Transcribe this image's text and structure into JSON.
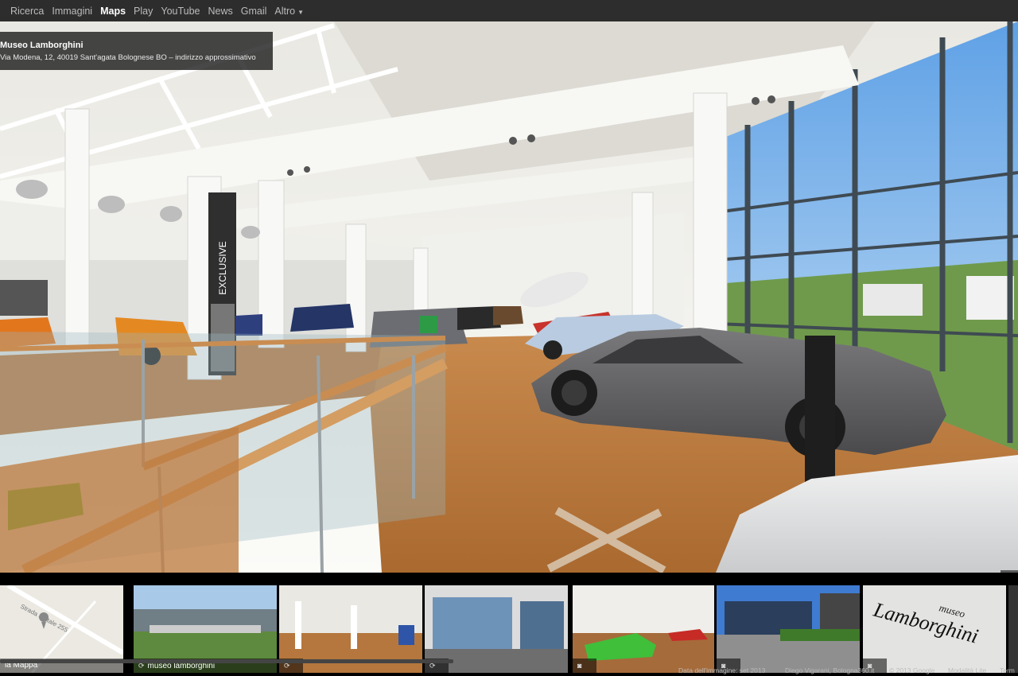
{
  "topbar": {
    "items": [
      {
        "label": "Ricerca",
        "active": false
      },
      {
        "label": "Immagini",
        "active": false
      },
      {
        "label": "Maps",
        "active": true
      },
      {
        "label": "Play",
        "active": false
      },
      {
        "label": "YouTube",
        "active": false
      },
      {
        "label": "News",
        "active": false
      },
      {
        "label": "Gmail",
        "active": false
      },
      {
        "label": "Altro",
        "active": false,
        "icon": "chevron-down-icon"
      }
    ]
  },
  "place": {
    "title": "Museo Lamborghini",
    "address": "Via Modena, 12, 40019 Sant'agata Bolognese BO – indirizzo approssimativo"
  },
  "pano": {
    "sign_text": "EXCLUSIVE",
    "colors": {
      "floor": "#b7773e",
      "ceiling": "#f2f1ec",
      "car": "#5d5d5f",
      "accent": "#e69a2a"
    }
  },
  "filmstrip": {
    "map_label": "la Mappa",
    "map_road": "Strada Statale 255",
    "thumbs": [
      {
        "label": "museo lamborghini",
        "icon": "streetview-360-icon"
      },
      {
        "label": "",
        "icon": "streetview-360-icon"
      },
      {
        "label": "",
        "icon": "streetview-360-icon"
      },
      {
        "label": "",
        "icon": "camera-icon"
      },
      {
        "label": "",
        "icon": "camera-icon"
      },
      {
        "label": "",
        "icon": "camera-icon"
      }
    ],
    "logo_text": "Lamborghini",
    "logo_small": "museo"
  },
  "footer": {
    "date": "Data dell'immagine: set 2013",
    "author": "Diego Vigarani, Bologna360.it",
    "copyright": "© 2013 Google",
    "mode": "Modalità Lite",
    "terms": "Term"
  }
}
